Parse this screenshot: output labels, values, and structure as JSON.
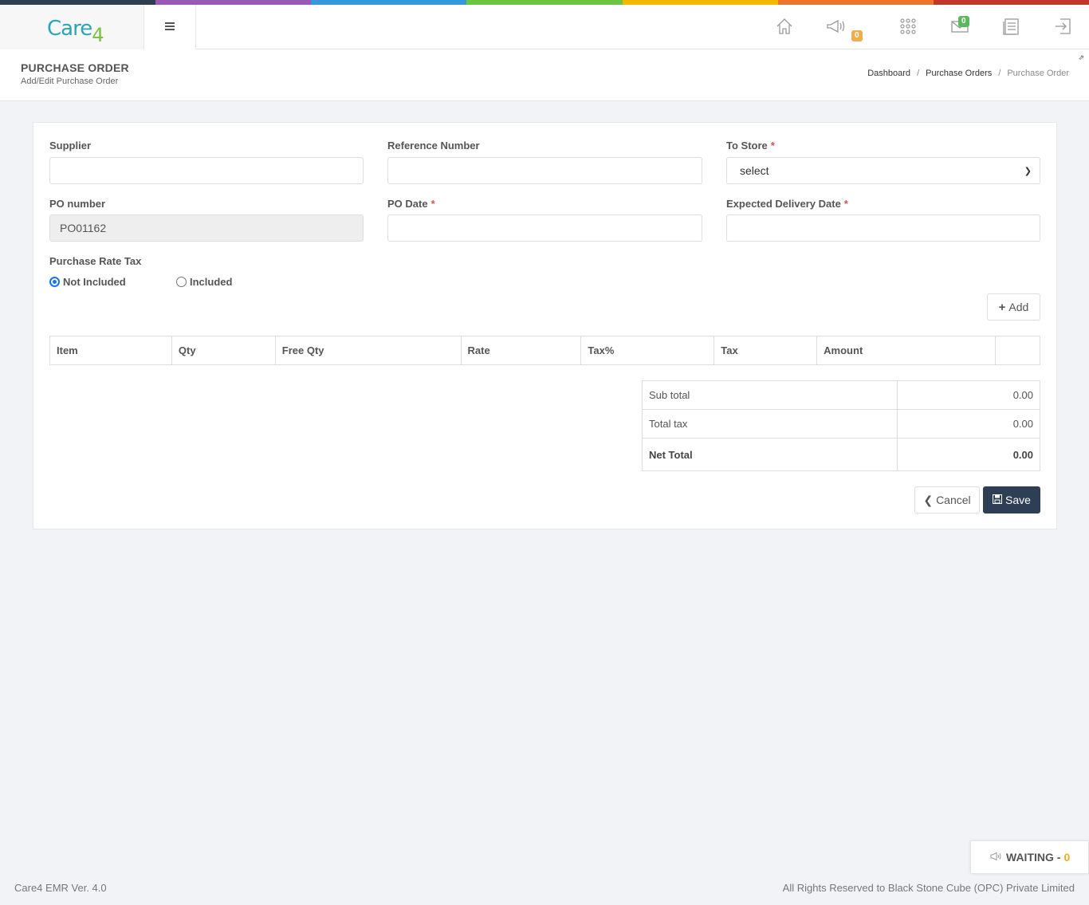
{
  "colors": {
    "stripe": [
      "#2c3e50",
      "#9b59b6",
      "#3498db",
      "#6cc644",
      "#f5b800",
      "#ee7530",
      "#c0392b"
    ],
    "accent": "#2e3e55",
    "notif_badge": "#f0ad4e",
    "mail_badge": "#5cb85c"
  },
  "brand": {
    "logo_text": "Care",
    "logo_suffix": "4"
  },
  "topnav": {
    "icons": [
      "home-icon",
      "megaphone-icon",
      "apps-grid-icon",
      "mail-icon",
      "document-icon",
      "logout-icon"
    ],
    "notifications_count": "0",
    "mail_count": "0"
  },
  "header": {
    "title": "PURCHASE ORDER",
    "subtitle": "Add/Edit Purchase Order",
    "breadcrumb": [
      "Dashboard",
      "Purchase Orders",
      "Purchase Order"
    ],
    "breadcrumb_sep": "/"
  },
  "form": {
    "supplier_label": "Supplier",
    "supplier_value": "",
    "reference_label": "Reference Number",
    "reference_value": "",
    "to_store_label": "To Store",
    "to_store_value": "select",
    "required_mark": "*",
    "po_number_label": "PO number",
    "po_number_value": "PO01162",
    "po_date_label": "PO Date",
    "po_date_value": "",
    "delivery_label": "Expected Delivery Date",
    "delivery_value": "",
    "tax_label": "Purchase Rate Tax",
    "tax_options": [
      "Not Included",
      "Included"
    ],
    "tax_selected": "Not Included"
  },
  "add_label": "Add",
  "table": {
    "columns": [
      "Item",
      "Qty",
      "Free Qty",
      "Rate",
      "Tax%",
      "Tax",
      "Amount",
      ""
    ]
  },
  "totals": {
    "sub_total_label": "Sub total",
    "sub_total_value": "0.00",
    "total_tax_label": "Total tax",
    "total_tax_value": "0.00",
    "net_total_label": "Net Total",
    "net_total_value": "0.00"
  },
  "actions": {
    "cancel": "Cancel",
    "save": "Save"
  },
  "waiting": {
    "label": "WAITING - ",
    "count": "0"
  },
  "footer": {
    "version": "Care4 EMR Ver. 4.0",
    "copyright": "All Rights Reserved to Black Stone Cube (OPC) Private Limited"
  }
}
